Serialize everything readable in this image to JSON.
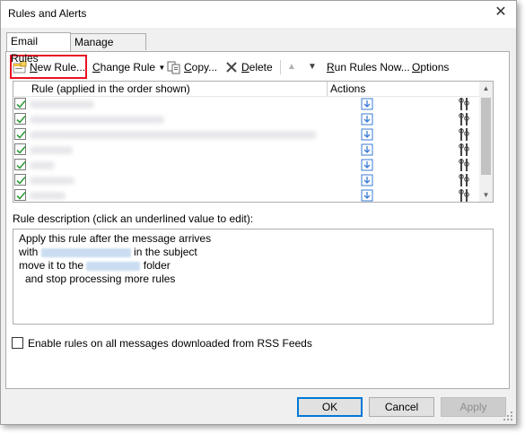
{
  "window": {
    "title": "Rules and Alerts",
    "close_label": "✕"
  },
  "tabs": [
    {
      "label": "Email Rules",
      "active": true
    },
    {
      "label": "Manage Alerts",
      "active": false
    }
  ],
  "toolbar": {
    "new_rule": {
      "underline": "N",
      "rest": "ew Rule..."
    },
    "change_rule": {
      "underline": "C",
      "rest": "hange Rule"
    },
    "copy": {
      "underline": "C",
      "rest": "opy..."
    },
    "delete": {
      "underline": "D",
      "rest": "elete"
    },
    "run_rules": {
      "underline": "R",
      "rest": "un Rules Now..."
    },
    "options": {
      "underline": "O",
      "rest": "ptions"
    }
  },
  "rules_table": {
    "col_rule": "Rule (applied in the order shown)",
    "col_actions": "Actions",
    "rows": [
      {
        "checked": true
      },
      {
        "checked": true
      },
      {
        "checked": true
      },
      {
        "checked": true
      },
      {
        "checked": true
      },
      {
        "checked": true
      },
      {
        "checked": true
      }
    ]
  },
  "description": {
    "label": "Rule description (click an underlined value to edit):",
    "line1": "Apply this rule after the message arrives",
    "line2_prefix": "with",
    "line2_suffix": "in the subject",
    "line3_prefix": "move it to the",
    "line3_suffix": "folder",
    "line4": "and stop processing more rules"
  },
  "rss": {
    "label": "Enable rules on all messages downloaded from RSS Feeds",
    "checked": false
  },
  "buttons": {
    "ok": "OK",
    "cancel": "Cancel",
    "apply": "Apply"
  },
  "colors": {
    "highlight": "#e81123",
    "check": "#2e9d3a",
    "default_button": "#0078d7"
  }
}
